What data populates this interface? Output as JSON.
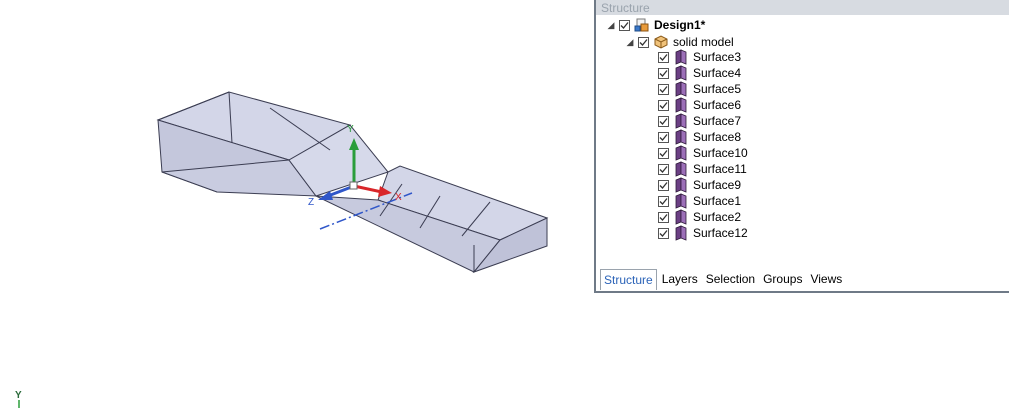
{
  "panel": {
    "title": "Structure",
    "tree": {
      "root": {
        "label": "Design1*",
        "checked": true,
        "icon": "design-icon"
      },
      "model": {
        "label": "solid model",
        "checked": true,
        "icon": "solid-model-icon"
      },
      "surfaces": [
        "Surface3",
        "Surface4",
        "Surface5",
        "Surface6",
        "Surface7",
        "Surface8",
        "Surface10",
        "Surface11",
        "Surface9",
        "Surface1",
        "Surface2",
        "Surface12"
      ]
    },
    "tabs": [
      {
        "label": "Structure",
        "active": true
      },
      {
        "label": "Layers",
        "active": false
      },
      {
        "label": "Selection",
        "active": false
      },
      {
        "label": "Groups",
        "active": false
      },
      {
        "label": "Views",
        "active": false
      }
    ]
  },
  "viewport": {
    "triad_labels": {
      "x": "X",
      "y": "Y",
      "z": "Z"
    },
    "corner_axis_label": "Y"
  },
  "colors": {
    "model_fill": "#cdd0e3",
    "model_edge": "#3b3d52",
    "axis_x": "#d9262a",
    "axis_y": "#2a9d3b",
    "axis_z": "#2f56c9",
    "surface_icon": "#6b3f84",
    "tab_active": "#2b63b8"
  }
}
